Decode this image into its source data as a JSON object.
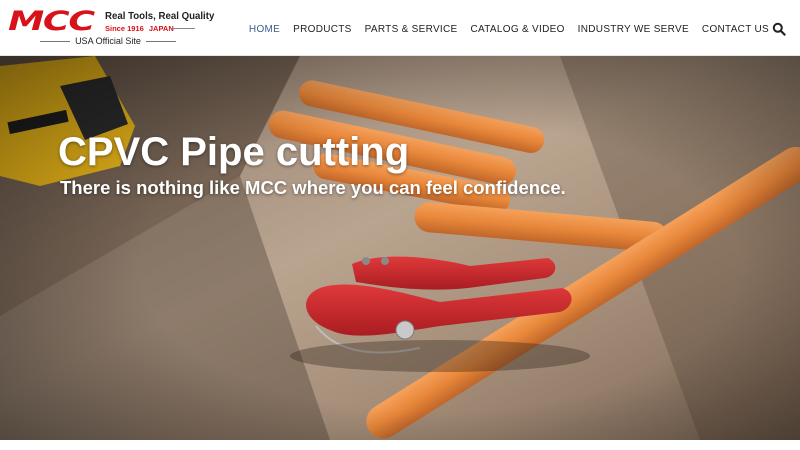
{
  "brand": {
    "logo_text": "MCC",
    "tagline": "Real Tools, Real Quality",
    "since": "Since 1916",
    "country": "JAPAN",
    "site_label": "USA Official Site"
  },
  "nav": {
    "items": [
      {
        "label": "HOME",
        "active": true
      },
      {
        "label": "PRODUCTS",
        "active": false
      },
      {
        "label": "PARTS & SERVICE",
        "active": false
      },
      {
        "label": "CATALOG & VIDEO",
        "active": false
      },
      {
        "label": "INDUSTRY WE SERVE",
        "active": false
      },
      {
        "label": "CONTACT US",
        "active": false
      }
    ],
    "search_icon": "search-icon"
  },
  "hero": {
    "title": "CPVC Pipe cutting",
    "subtitle": "There is nothing like MCC where you can feel confidence."
  },
  "colors": {
    "brand_red": "#d7121a",
    "nav_active": "#3a5f8a",
    "nav_text": "#222222",
    "pipe_orange": "#e8873a"
  }
}
